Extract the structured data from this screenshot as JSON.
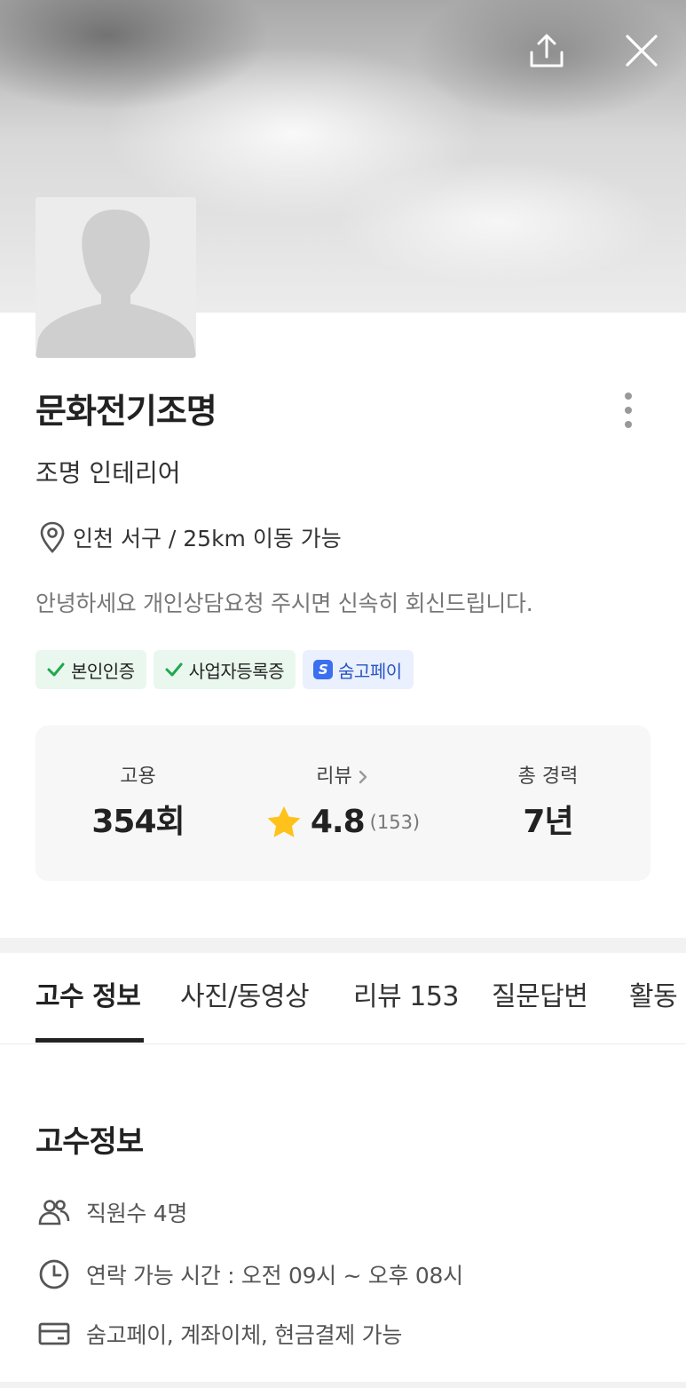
{
  "profile": {
    "name": "문화전기조명",
    "category": "조명 인테리어",
    "location": "인천 서구 / 25km 이동 가능",
    "intro": "안녕하세요 개인상담요청 주시면 신속히 회신드립니다."
  },
  "badges": [
    {
      "label": "본인인증",
      "icon": "check-icon"
    },
    {
      "label": "사업자등록증",
      "icon": "check-icon"
    },
    {
      "label": "숨고페이",
      "icon": "soomgo-pay-logo",
      "logo_text": "S"
    }
  ],
  "stats": {
    "hire": {
      "label": "고용",
      "value": "354회"
    },
    "review": {
      "label": "리뷰",
      "rating": "4.8",
      "count": "(153)"
    },
    "career": {
      "label": "총 경력",
      "value": "7년"
    }
  },
  "tabs": [
    {
      "label": "고수 정보",
      "active": true
    },
    {
      "label": "사진/동영상",
      "active": false
    },
    {
      "label": "리뷰 153",
      "active": false
    },
    {
      "label": "질문답변",
      "active": false
    },
    {
      "label": "활동",
      "active": false
    }
  ],
  "info": {
    "title": "고수정보",
    "rows": [
      {
        "icon": "people-icon",
        "text": "직원수 4명"
      },
      {
        "icon": "clock-icon",
        "text": "연락 가능 시간 : 오전 09시  ~ 오후 08시"
      },
      {
        "icon": "card-icon",
        "text": "숨고페이, 계좌이체, 현금결제 가능"
      }
    ]
  },
  "colors": {
    "accent_green": "#1fa84f",
    "accent_blue": "#3b6ff0",
    "star": "#ffc21a"
  }
}
